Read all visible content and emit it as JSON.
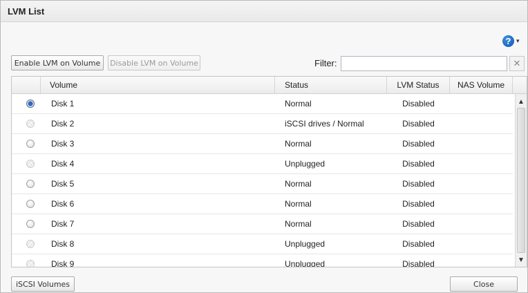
{
  "dialog": {
    "title": "LVM List"
  },
  "help": {
    "icon": "help-icon",
    "symbol": "?",
    "caret": "▾"
  },
  "toolbar": {
    "enable_label": "Enable LVM on Volume",
    "disable_label": "Disable LVM on Volume",
    "filter_label": "Filter:",
    "filter_value": "",
    "filter_clear": "✕"
  },
  "grid": {
    "columns": {
      "volume": "Volume",
      "status": "Status",
      "lvm_status": "LVM Status",
      "nas_volume": "NAS Volume"
    },
    "rows": [
      {
        "volume": "Disk 1",
        "status": "Normal",
        "lvm_status": "Disabled",
        "nas_volume": "",
        "radio": "selected"
      },
      {
        "volume": "Disk 2",
        "status": "iSCSI drives / Normal",
        "lvm_status": "Disabled",
        "nas_volume": "",
        "radio": "disabled"
      },
      {
        "volume": "Disk 3",
        "status": "Normal",
        "lvm_status": "Disabled",
        "nas_volume": "",
        "radio": "enabled"
      },
      {
        "volume": "Disk 4",
        "status": "Unplugged",
        "lvm_status": "Disabled",
        "nas_volume": "",
        "radio": "disabled"
      },
      {
        "volume": "Disk 5",
        "status": "Normal",
        "lvm_status": "Disabled",
        "nas_volume": "",
        "radio": "enabled"
      },
      {
        "volume": "Disk 6",
        "status": "Normal",
        "lvm_status": "Disabled",
        "nas_volume": "",
        "radio": "enabled"
      },
      {
        "volume": "Disk 7",
        "status": "Normal",
        "lvm_status": "Disabled",
        "nas_volume": "",
        "radio": "enabled"
      },
      {
        "volume": "Disk 8",
        "status": "Unplugged",
        "lvm_status": "Disabled",
        "nas_volume": "",
        "radio": "disabled"
      },
      {
        "volume": "Disk 9",
        "status": "Unplugged",
        "lvm_status": "Disabled",
        "nas_volume": "",
        "radio": "disabled"
      }
    ]
  },
  "scroll": {
    "up": "▲",
    "down": "▼"
  },
  "footer": {
    "iscsi_label": "iSCSI Volumes",
    "close_label": "Close"
  }
}
